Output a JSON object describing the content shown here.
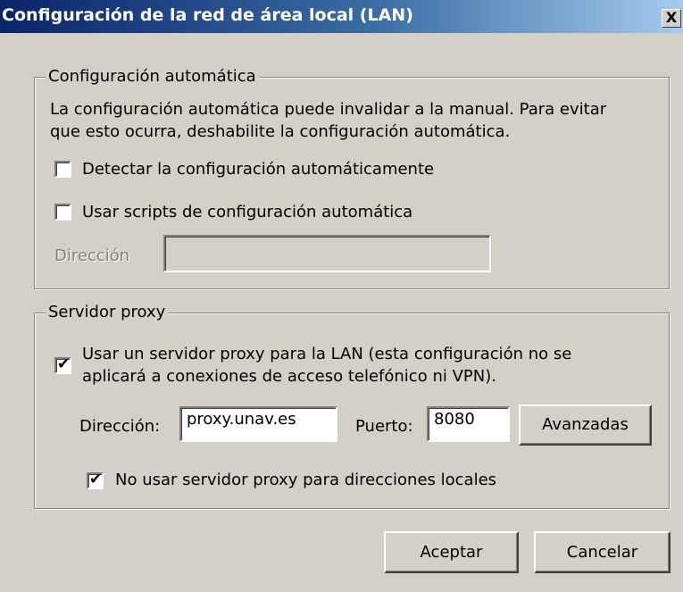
{
  "window": {
    "title": "Configuración de la red de área local (LAN)",
    "close_glyph": "X"
  },
  "auto_config": {
    "legend": "Configuración automática",
    "description_line1": "La configuración automática puede invalidar a la manual. Para evitar",
    "description_line2": "que esto ocurra, deshabilite la configuración automática.",
    "detect_label": "Detectar la configuración automáticamente",
    "detect_checked": false,
    "scripts_label": "Usar scripts de configuración automática",
    "scripts_checked": false,
    "address_label": "Dirección",
    "address_value": ""
  },
  "proxy": {
    "legend": "Servidor proxy",
    "use_proxy_line1": "Usar un servidor proxy para la LAN (esta configuración no se",
    "use_proxy_line2": "aplicará a conexiones de acceso telefónico ni VPN).",
    "use_proxy_checked": true,
    "address_label": "Dirección:",
    "address_value": "proxy.unav.es",
    "port_label": "Puerto:",
    "port_value": "8080",
    "advanced_label": "Avanzadas",
    "bypass_label": "No usar servidor proxy para direcciones locales",
    "bypass_checked": true
  },
  "buttons": {
    "ok": "Aceptar",
    "cancel": "Cancelar"
  }
}
